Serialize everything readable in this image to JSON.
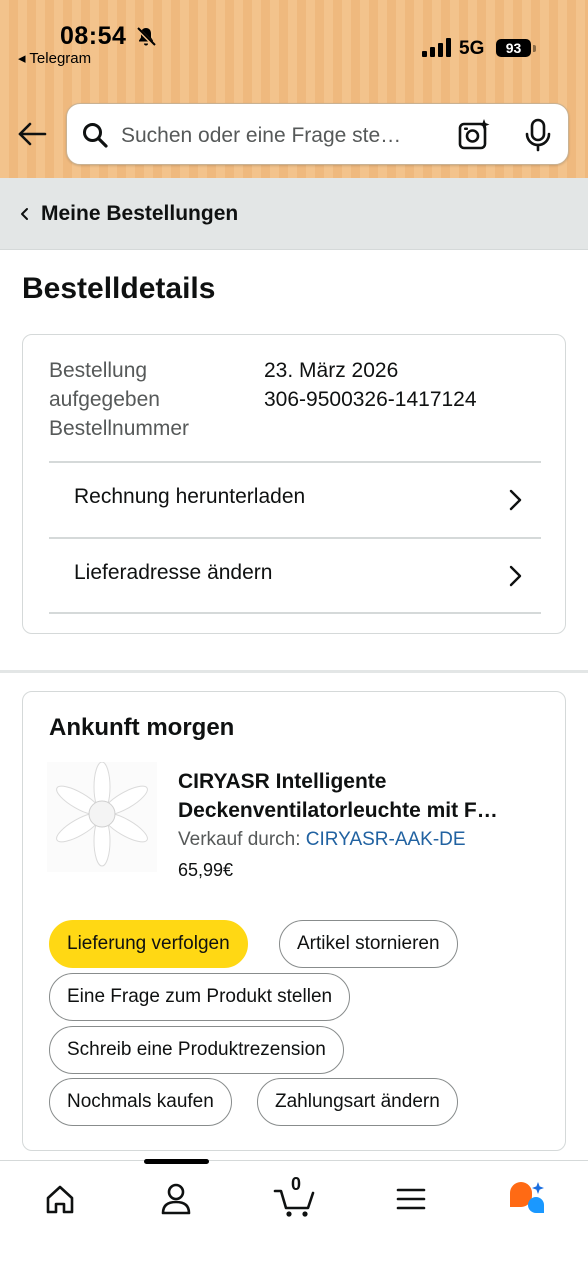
{
  "status_bar": {
    "time": "08:54",
    "back_app": "◂ Telegram",
    "network": "5G",
    "battery": "93"
  },
  "search": {
    "placeholder": "Suchen oder eine Frage ste…"
  },
  "breadcrumb": {
    "label": "Meine Bestellungen"
  },
  "page_title": "Bestelldetails",
  "order": {
    "placed_label_line1": "Bestellung",
    "placed_label_line2": "aufgegeben",
    "placed_value": "23. März 2026",
    "number_label": "Bestellnummer",
    "number_value": "306-9500326-1417124",
    "links": [
      {
        "label": "Rechnung herunterladen"
      },
      {
        "label": "Lieferadresse ändern"
      }
    ]
  },
  "shipment": {
    "arrival": "Ankunft morgen",
    "product_title_line1": "CIRYASR Intelligente",
    "product_title_line2": "Deckenventilatorleuchte mit F…",
    "seller_prefix": "Verkauf durch: ",
    "seller_name": "CIRYASR-AAK-DE",
    "price": "65,99€",
    "actions": [
      {
        "label": "Lieferung verfolgen",
        "primary": true
      },
      {
        "label": "Artikel stornieren"
      },
      {
        "label": "Eine Frage zum Produkt stellen"
      },
      {
        "label": "Schreib eine Produktrezension"
      },
      {
        "label": "Nochmals kaufen"
      },
      {
        "label": "Zahlungsart ändern"
      }
    ]
  },
  "bottom_nav": {
    "items": [
      {
        "icon": "home-icon"
      },
      {
        "icon": "account-icon",
        "active": true
      },
      {
        "icon": "cart-icon"
      },
      {
        "icon": "menu-icon"
      },
      {
        "icon": "rufus-icon"
      }
    ],
    "cart_count": "0"
  },
  "colors": {
    "header_bg": "#f3c38c",
    "primary_button": "#ffd814",
    "link": "#2162a1",
    "breadcrumb_bg": "#e3e6e6"
  }
}
